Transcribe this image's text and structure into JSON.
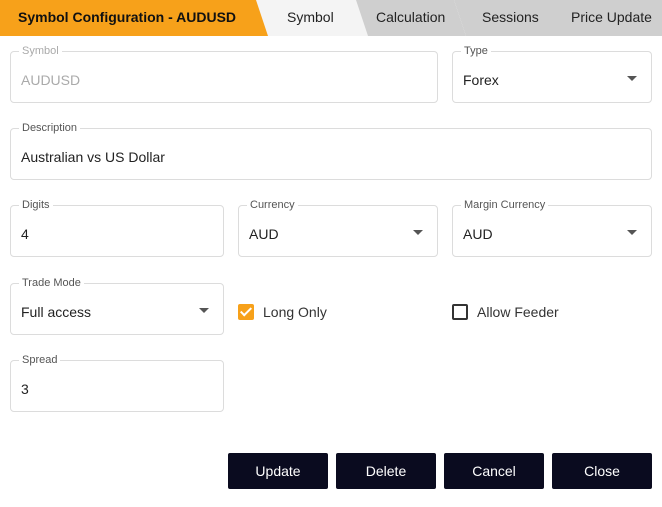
{
  "header": {
    "title": "Symbol Configuration - AUDUSD",
    "tabs": [
      "Symbol",
      "Calculation",
      "Sessions",
      "Price Update"
    ],
    "active_tab": "Symbol",
    "accent_color": "#f7a11a"
  },
  "form": {
    "symbol": {
      "label": "Symbol",
      "value": "AUDUSD",
      "disabled": true
    },
    "type": {
      "label": "Type",
      "value": "Forex"
    },
    "description": {
      "label": "Description",
      "value": "Australian vs US Dollar"
    },
    "digits": {
      "label": "Digits",
      "value": "4"
    },
    "currency": {
      "label": "Currency",
      "value": "AUD"
    },
    "margin_currency": {
      "label": "Margin Currency",
      "value": "AUD"
    },
    "trade_mode": {
      "label": "Trade Mode",
      "value": "Full access"
    },
    "long_only": {
      "label": "Long Only",
      "checked": true
    },
    "allow_feeder": {
      "label": "Allow Feeder",
      "checked": false
    },
    "spread": {
      "label": "Spread",
      "value": "3"
    }
  },
  "actions": {
    "update": "Update",
    "delete": "Delete",
    "cancel": "Cancel",
    "close": "Close"
  }
}
